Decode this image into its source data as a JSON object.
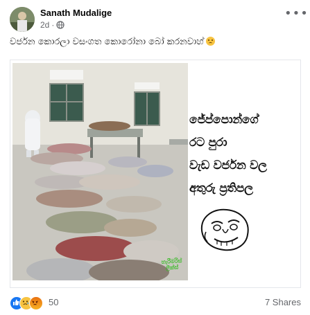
{
  "post": {
    "author_name": "Sanath Mudalige",
    "timestamp": "2d",
    "audience_icon": "globe-icon",
    "more_icon": "more-options-icon",
    "caption": "වර්ජන කොරලා වසංගත කොරෝනා බෝ කරනවාහ්",
    "caption_emoji": "disappointed-face-icon"
  },
  "media": {
    "meme_lines": [
      "ජේප්පොන්ගේ",
      "රට පුරා",
      "වැඩ වර්ජන වල",
      "අතුරු ප්‍රතිපල"
    ],
    "watermark_lines": [
      "හැරීමරිස්",
      "ලීක්ස්"
    ]
  },
  "footer": {
    "reaction_icons": [
      "like-icon",
      "sad-icon",
      "angry-icon"
    ],
    "reaction_count": "50",
    "shares": "7 Shares"
  },
  "colors": {
    "text_primary": "#050505",
    "text_secondary": "#65676b",
    "like_blue": "#1877f2",
    "watermark_green": "#3dbb2a"
  }
}
